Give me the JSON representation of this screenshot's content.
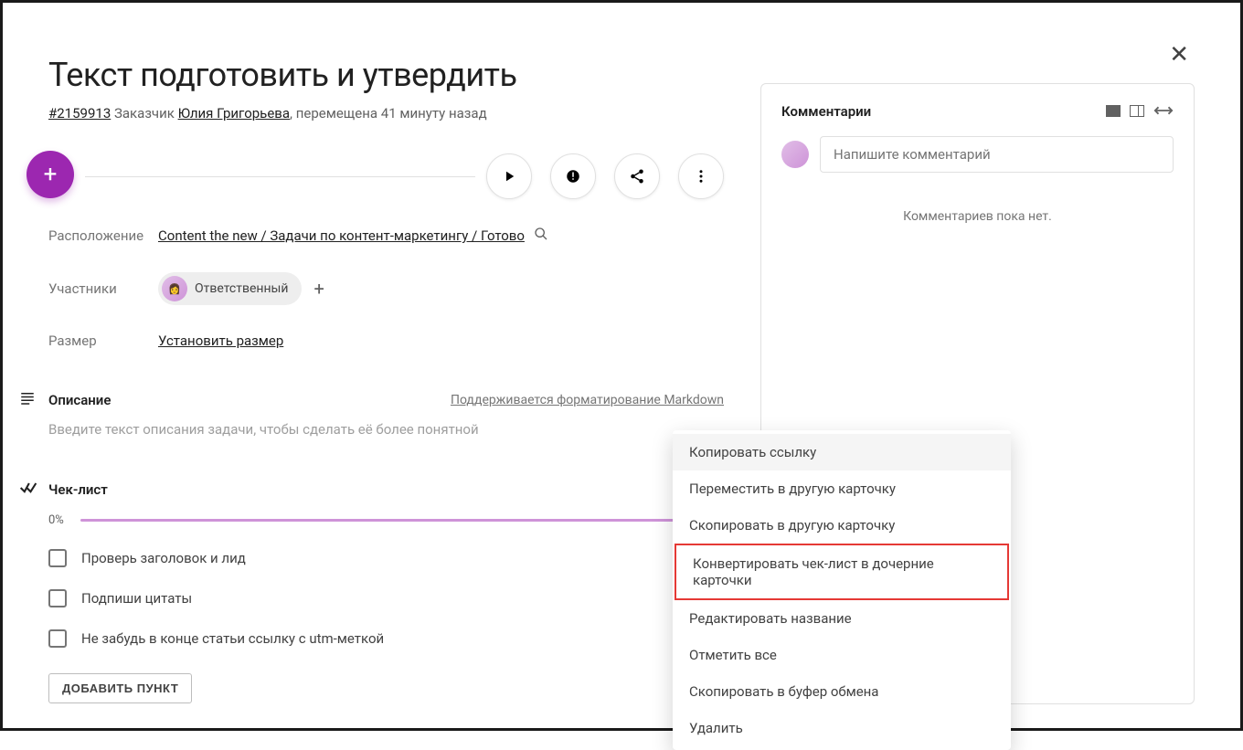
{
  "card": {
    "title": "Текст подготовить и утвердить",
    "id": "#2159913",
    "customer_label": "Заказчик",
    "customer_name": "Юлия Григорьева",
    "moved_text": ", перемещена 41 минуту назад"
  },
  "fields": {
    "location_label": "Расположение",
    "location_value": "Content the new / Задачи по контент-маркетингу / Готово",
    "participants_label": "Участники",
    "responsible_chip": "Ответственный",
    "size_label": "Размер",
    "size_value": "Установить размер"
  },
  "description": {
    "title": "Описание",
    "hint": "Поддерживается форматирование Markdown",
    "placeholder": "Введите текст описания задачи, чтобы сделать её более понятной"
  },
  "checklist": {
    "title": "Чек-лист",
    "progress": "0%",
    "items": [
      "Проверь заголовок и лид",
      "Подпиши цитаты",
      "Не забудь в конце статьи ссылку с utm-меткой"
    ],
    "add_button": "ДОБАВИТЬ ПУНКТ"
  },
  "comments": {
    "title": "Комментарии",
    "placeholder": "Напишите комментарий",
    "empty": "Комментариев пока нет."
  },
  "menu": {
    "items": [
      "Копировать ссылку",
      "Переместить в другую карточку",
      "Скопировать в другую карточку",
      "Конвертировать чек-лист в дочерние карточки",
      "Редактировать название",
      "Отметить все",
      "Скопировать в буфер обмена",
      "Удалить"
    ],
    "hover_index": 0,
    "highlight_index": 3
  }
}
